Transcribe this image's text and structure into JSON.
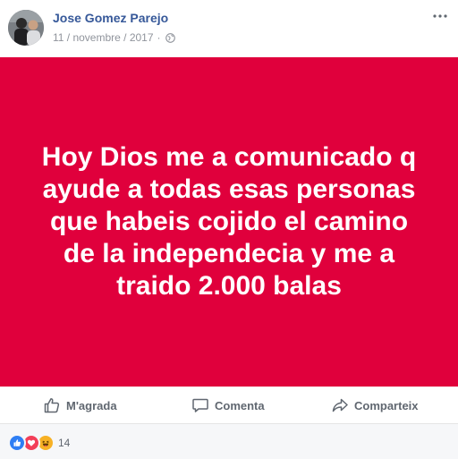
{
  "post": {
    "author": "Jose Gomez Parejo",
    "date": "11 / novembre / 2017",
    "separator": "·",
    "privacy_icon": "globe-icon",
    "menu_icon": "more-options-icon",
    "status": {
      "text": "Hoy Dios me a comunicado q ayude a todas esas personas que habeis cojido el camino de la independecia y me a traido 2.000 balas",
      "background_color": "#e0003c",
      "text_color": "#ffffff"
    }
  },
  "actions": {
    "like": {
      "label": "M'agrada",
      "icon": "thumbs-up-icon"
    },
    "comment": {
      "label": "Comenta",
      "icon": "comment-icon"
    },
    "share": {
      "label": "Comparteix",
      "icon": "share-arrow-icon"
    }
  },
  "reactions": {
    "icons": [
      "like-reaction-icon",
      "love-reaction-icon",
      "haha-reaction-icon"
    ],
    "count": "14"
  },
  "colors": {
    "link": "#365899",
    "meta": "#90949c",
    "action_text": "#606770",
    "footer_bg": "#f6f7f9"
  }
}
